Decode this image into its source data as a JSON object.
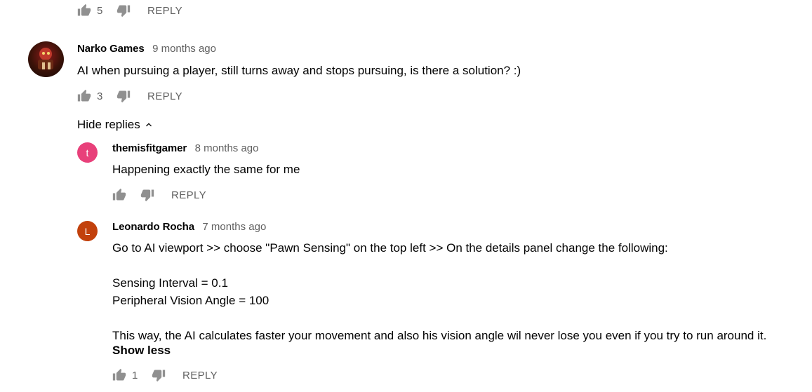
{
  "top_actions": {
    "like_count": "5",
    "reply_label": "REPLY"
  },
  "comment": {
    "author": "Narko Games",
    "time": "9 months ago",
    "text": "AI when pursuing a player, still turns away and stops pursuing, is there a solution? :)",
    "like_count": "3",
    "reply_label": "REPLY",
    "hide_replies_label": "Hide replies"
  },
  "replies": [
    {
      "avatar_letter": "t",
      "avatar_color": "#e8407a",
      "author": "themisfitgamer",
      "time": "8 months ago",
      "text": "Happening exactly the same for me",
      "like_count": "",
      "reply_label": "REPLY"
    },
    {
      "avatar_letter": "L",
      "avatar_color": "#c2410c",
      "author": "Leonardo Rocha",
      "time": "7 months ago",
      "lines": [
        "Go to AI viewport >> choose \"Pawn Sensing\" on the top left >> On the details panel change the following:",
        "Sensing Interval = 0.1",
        "Peripheral Vision Angle = 100",
        "This way, the AI calculates faster your movement and also his vision angle wil never lose you even if you try to run around it."
      ],
      "show_less_label": "Show less",
      "like_count": "1",
      "reply_label": "REPLY"
    }
  ]
}
